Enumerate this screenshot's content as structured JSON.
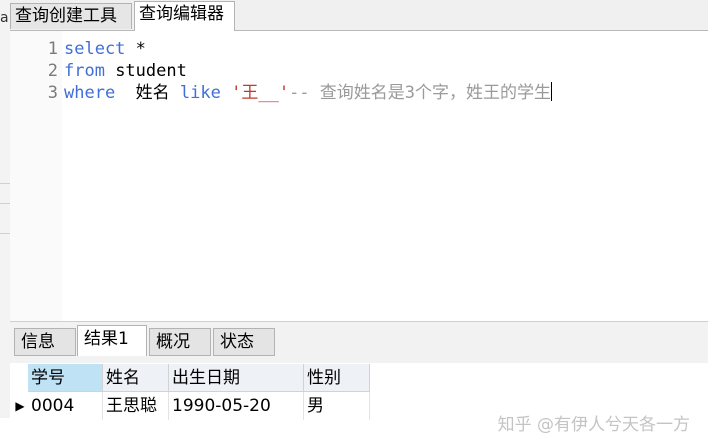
{
  "tabs": [
    {
      "label": "查询创建工具",
      "active": false
    },
    {
      "label": "查询编辑器",
      "active": true
    }
  ],
  "left_clip_char": "a",
  "editor": {
    "line_numbers": [
      "1",
      "2",
      "3"
    ],
    "lines": [
      [
        {
          "t": "select",
          "c": "kw"
        },
        {
          "t": " *",
          "c": ""
        }
      ],
      [
        {
          "t": "from",
          "c": "kw"
        },
        {
          "t": " student",
          "c": ""
        }
      ],
      [
        {
          "t": "where",
          "c": "kw"
        },
        {
          "t": "  姓名 ",
          "c": ""
        },
        {
          "t": "like",
          "c": "kw"
        },
        {
          "t": " ",
          "c": ""
        },
        {
          "t": "'王__'",
          "c": "str"
        },
        {
          "t": "-- 查询姓名是3个字，姓王的学生",
          "c": "cmt"
        }
      ]
    ]
  },
  "result_tabs": [
    {
      "label": "信息",
      "active": false
    },
    {
      "label": "结果1",
      "active": true
    },
    {
      "label": "概况",
      "active": false
    },
    {
      "label": "状态",
      "active": false
    }
  ],
  "grid": {
    "columns": [
      "学号",
      "姓名",
      "出生日期",
      "性别"
    ],
    "rows": [
      [
        "0004",
        "王思聪",
        "1990-05-20",
        "男"
      ]
    ]
  },
  "watermark": "知乎 @有伊人兮天各一方",
  "colors": {
    "keyword": "#3f6fd7",
    "string": "#c0392b",
    "comment": "#9a9a9a",
    "selected_header": "#bfe2f5"
  }
}
